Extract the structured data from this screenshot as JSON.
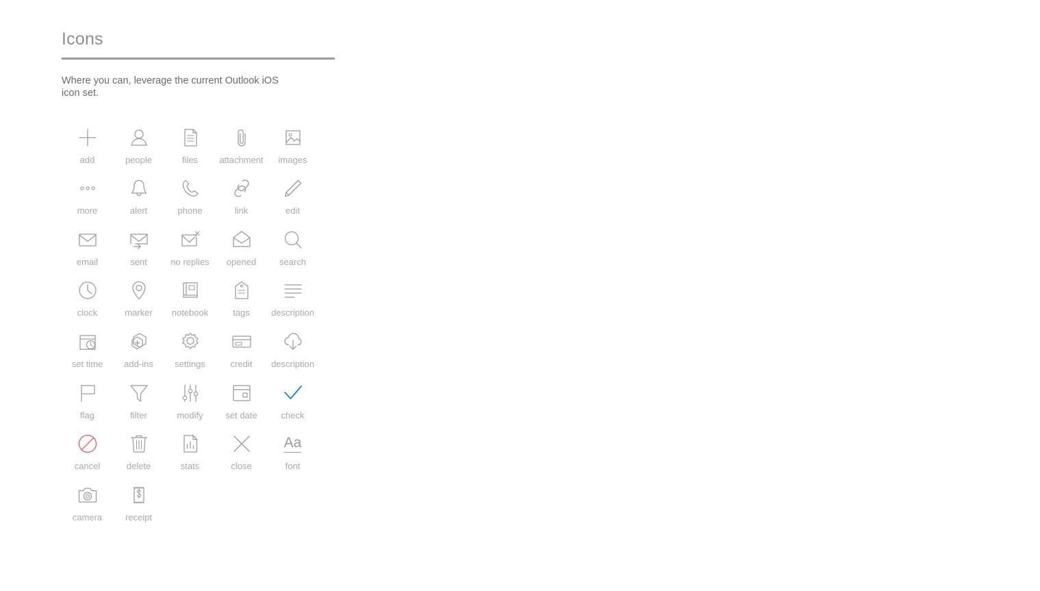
{
  "header": {
    "title": "Icons",
    "intro": "Where you can, leverage the current Outlook iOS icon set."
  },
  "colors": {
    "icon_stroke": "#9b9b9b",
    "label": "#a9a9a9",
    "accent_blue": "#1a8cdc",
    "accent_red": "#e8565a",
    "rule": "#9a9a9a",
    "background": "#ffffff"
  },
  "icon_grid": {
    "columns": 5,
    "items": [
      {
        "label": "add",
        "icon": "plus-icon",
        "color": "default"
      },
      {
        "label": "people",
        "icon": "person-icon",
        "color": "default"
      },
      {
        "label": "files",
        "icon": "document-icon",
        "color": "default"
      },
      {
        "label": "attachment",
        "icon": "paperclip-icon",
        "color": "default"
      },
      {
        "label": "images",
        "icon": "picture-icon",
        "color": "default"
      },
      {
        "label": "more",
        "icon": "ellipsis-icon",
        "color": "default"
      },
      {
        "label": "alert",
        "icon": "bell-icon",
        "color": "default"
      },
      {
        "label": "phone",
        "icon": "phone-icon",
        "color": "default"
      },
      {
        "label": "link",
        "icon": "link-icon",
        "color": "default"
      },
      {
        "label": "edit",
        "icon": "pencil-icon",
        "color": "default"
      },
      {
        "label": "email",
        "icon": "envelope-icon",
        "color": "default"
      },
      {
        "label": "sent",
        "icon": "envelope-arrow-icon",
        "color": "default"
      },
      {
        "label": "no replies",
        "icon": "envelope-x-icon",
        "color": "default"
      },
      {
        "label": "opened",
        "icon": "envelope-open-icon",
        "color": "default"
      },
      {
        "label": "search",
        "icon": "magnifier-icon",
        "color": "default"
      },
      {
        "label": "clock",
        "icon": "clock-icon",
        "color": "default"
      },
      {
        "label": "marker",
        "icon": "map-pin-icon",
        "color": "default"
      },
      {
        "label": "notebook",
        "icon": "notebook-icon",
        "color": "default"
      },
      {
        "label": "tags",
        "icon": "tag-icon",
        "color": "default"
      },
      {
        "label": "description",
        "icon": "text-lines-icon",
        "color": "default"
      },
      {
        "label": "set time",
        "icon": "calendar-clock-icon",
        "color": "default"
      },
      {
        "label": "add-ins",
        "icon": "hexagon-plus-icon",
        "color": "default"
      },
      {
        "label": "settings",
        "icon": "gear-icon",
        "color": "default"
      },
      {
        "label": "credit",
        "icon": "credit-card-icon",
        "color": "default"
      },
      {
        "label": "description",
        "icon": "cloud-download-icon",
        "color": "default"
      },
      {
        "label": "flag",
        "icon": "flag-icon",
        "color": "default"
      },
      {
        "label": "filter",
        "icon": "funnel-icon",
        "color": "default"
      },
      {
        "label": "modify",
        "icon": "sliders-icon",
        "color": "default"
      },
      {
        "label": "set date",
        "icon": "calendar-icon",
        "color": "default"
      },
      {
        "label": "check",
        "icon": "checkmark-icon",
        "color": "blue"
      },
      {
        "label": "cancel",
        "icon": "prohibited-icon",
        "color": "red"
      },
      {
        "label": "delete",
        "icon": "trash-icon",
        "color": "default"
      },
      {
        "label": "stats",
        "icon": "chart-document-icon",
        "color": "default"
      },
      {
        "label": "close",
        "icon": "x-icon",
        "color": "default"
      },
      {
        "label": "font",
        "icon": "font-aa-icon",
        "color": "default",
        "glyph": "Aa"
      },
      {
        "label": "camera",
        "icon": "camera-icon",
        "color": "default"
      },
      {
        "label": "receipt",
        "icon": "receipt-icon",
        "color": "default"
      }
    ]
  }
}
